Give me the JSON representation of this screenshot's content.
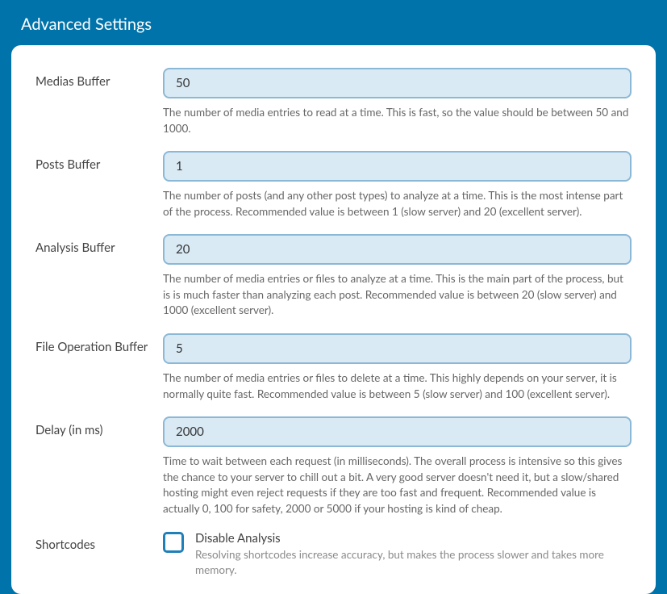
{
  "header": {
    "title": "Advanced Settings"
  },
  "fields": {
    "medias_buffer": {
      "label": "Medias Buffer",
      "value": "50",
      "help": "The number of media entries to read at a time. This is fast, so the value should be between 50 and 1000."
    },
    "posts_buffer": {
      "label": "Posts Buffer",
      "value": "1",
      "help": "The number of posts (and any other post types) to analyze at a time. This is the most intense part of the process. Recommended value is between 1 (slow server) and 20 (excellent server)."
    },
    "analysis_buffer": {
      "label": "Analysis Buffer",
      "value": "20",
      "help": "The number of media entries or files to analyze at a time. This is the main part of the process, but is is much faster than analyzing each post. Recommended value is between 20 (slow server) and 1000 (excellent server)."
    },
    "file_op_buffer": {
      "label": "File Operation Buffer",
      "value": "5",
      "help": "The number of media entries or files to delete at a time. This highly depends on your server, it is normally quite fast. Recommended value is between 5 (slow server) and 100 (excellent server)."
    },
    "delay": {
      "label": "Delay (in ms)",
      "value": "2000",
      "help": "Time to wait between each request (in milliseconds). The overall process is intensive so this gives the chance to your server to chill out a bit. A very good server doesn't need it, but a slow/shared hosting might even reject requests if they are too fast and frequent. Recommended value is actually 0, 100 for safety, 2000 or 5000 if your hosting is kind of cheap."
    },
    "shortcodes": {
      "label": "Shortcodes",
      "check_title": "Disable Analysis",
      "check_desc": "Resolving shortcodes increase accuracy, but makes the process slower and takes more memory."
    }
  }
}
